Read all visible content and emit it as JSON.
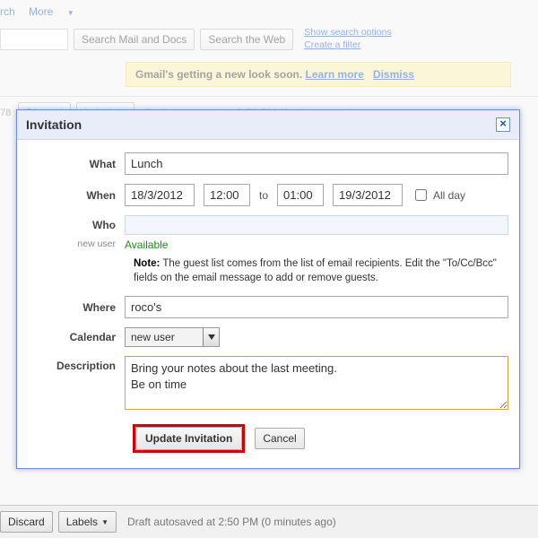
{
  "nav": {
    "rch": "rch",
    "more": "More",
    "more_icon": "▼"
  },
  "search": {
    "mail_docs_btn": "Search Mail and Docs",
    "web_btn": "Search the Web",
    "show_opts": "Show search options",
    "create_filter": "Create a filter"
  },
  "notice": {
    "text": "Gmail's getting a new look soon. ",
    "learn": "Learn more",
    "dismiss": "Dismiss"
  },
  "toolbar": {
    "num": "78",
    "discard": "Discard",
    "labels": "Labels",
    "tri": "▼",
    "draft": "Draft autosaved at 2:50 PM (0 minutes ago)"
  },
  "dialog": {
    "title": "Invitation",
    "close": "×",
    "labels": {
      "what": "What",
      "when": "When",
      "who": "Who",
      "where": "Where",
      "calendar": "Calendar",
      "description": "Description",
      "new_user": "new user",
      "to": "to",
      "all_day": "All day"
    },
    "values": {
      "what": "Lunch",
      "date_start": "18/3/2012",
      "time_start": "12:00",
      "time_end": "01:00",
      "date_end": "19/3/2012",
      "availability": "Available",
      "where": "roco's",
      "calendar": "new user",
      "description": "Bring your notes about the last meeting.\nBe on time"
    },
    "note": {
      "label": "Note:",
      "text": " The guest list comes from the list of email recipients. Edit the \"To/Cc/Bcc\" fields on the email message to add or remove guests."
    },
    "actions": {
      "update": "Update Invitation",
      "cancel": "Cancel"
    }
  }
}
